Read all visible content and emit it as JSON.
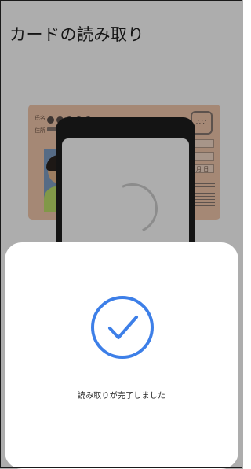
{
  "screen": {
    "title": "カードの読み取り"
  },
  "illustration": {
    "card_label_name": "氏名",
    "card_label_addr": "住所",
    "card_label_date": "月 日"
  },
  "dialog": {
    "message": "読み取りが完了しました",
    "icon": "check-circle-icon",
    "accent_color": "#3d7fe8"
  }
}
